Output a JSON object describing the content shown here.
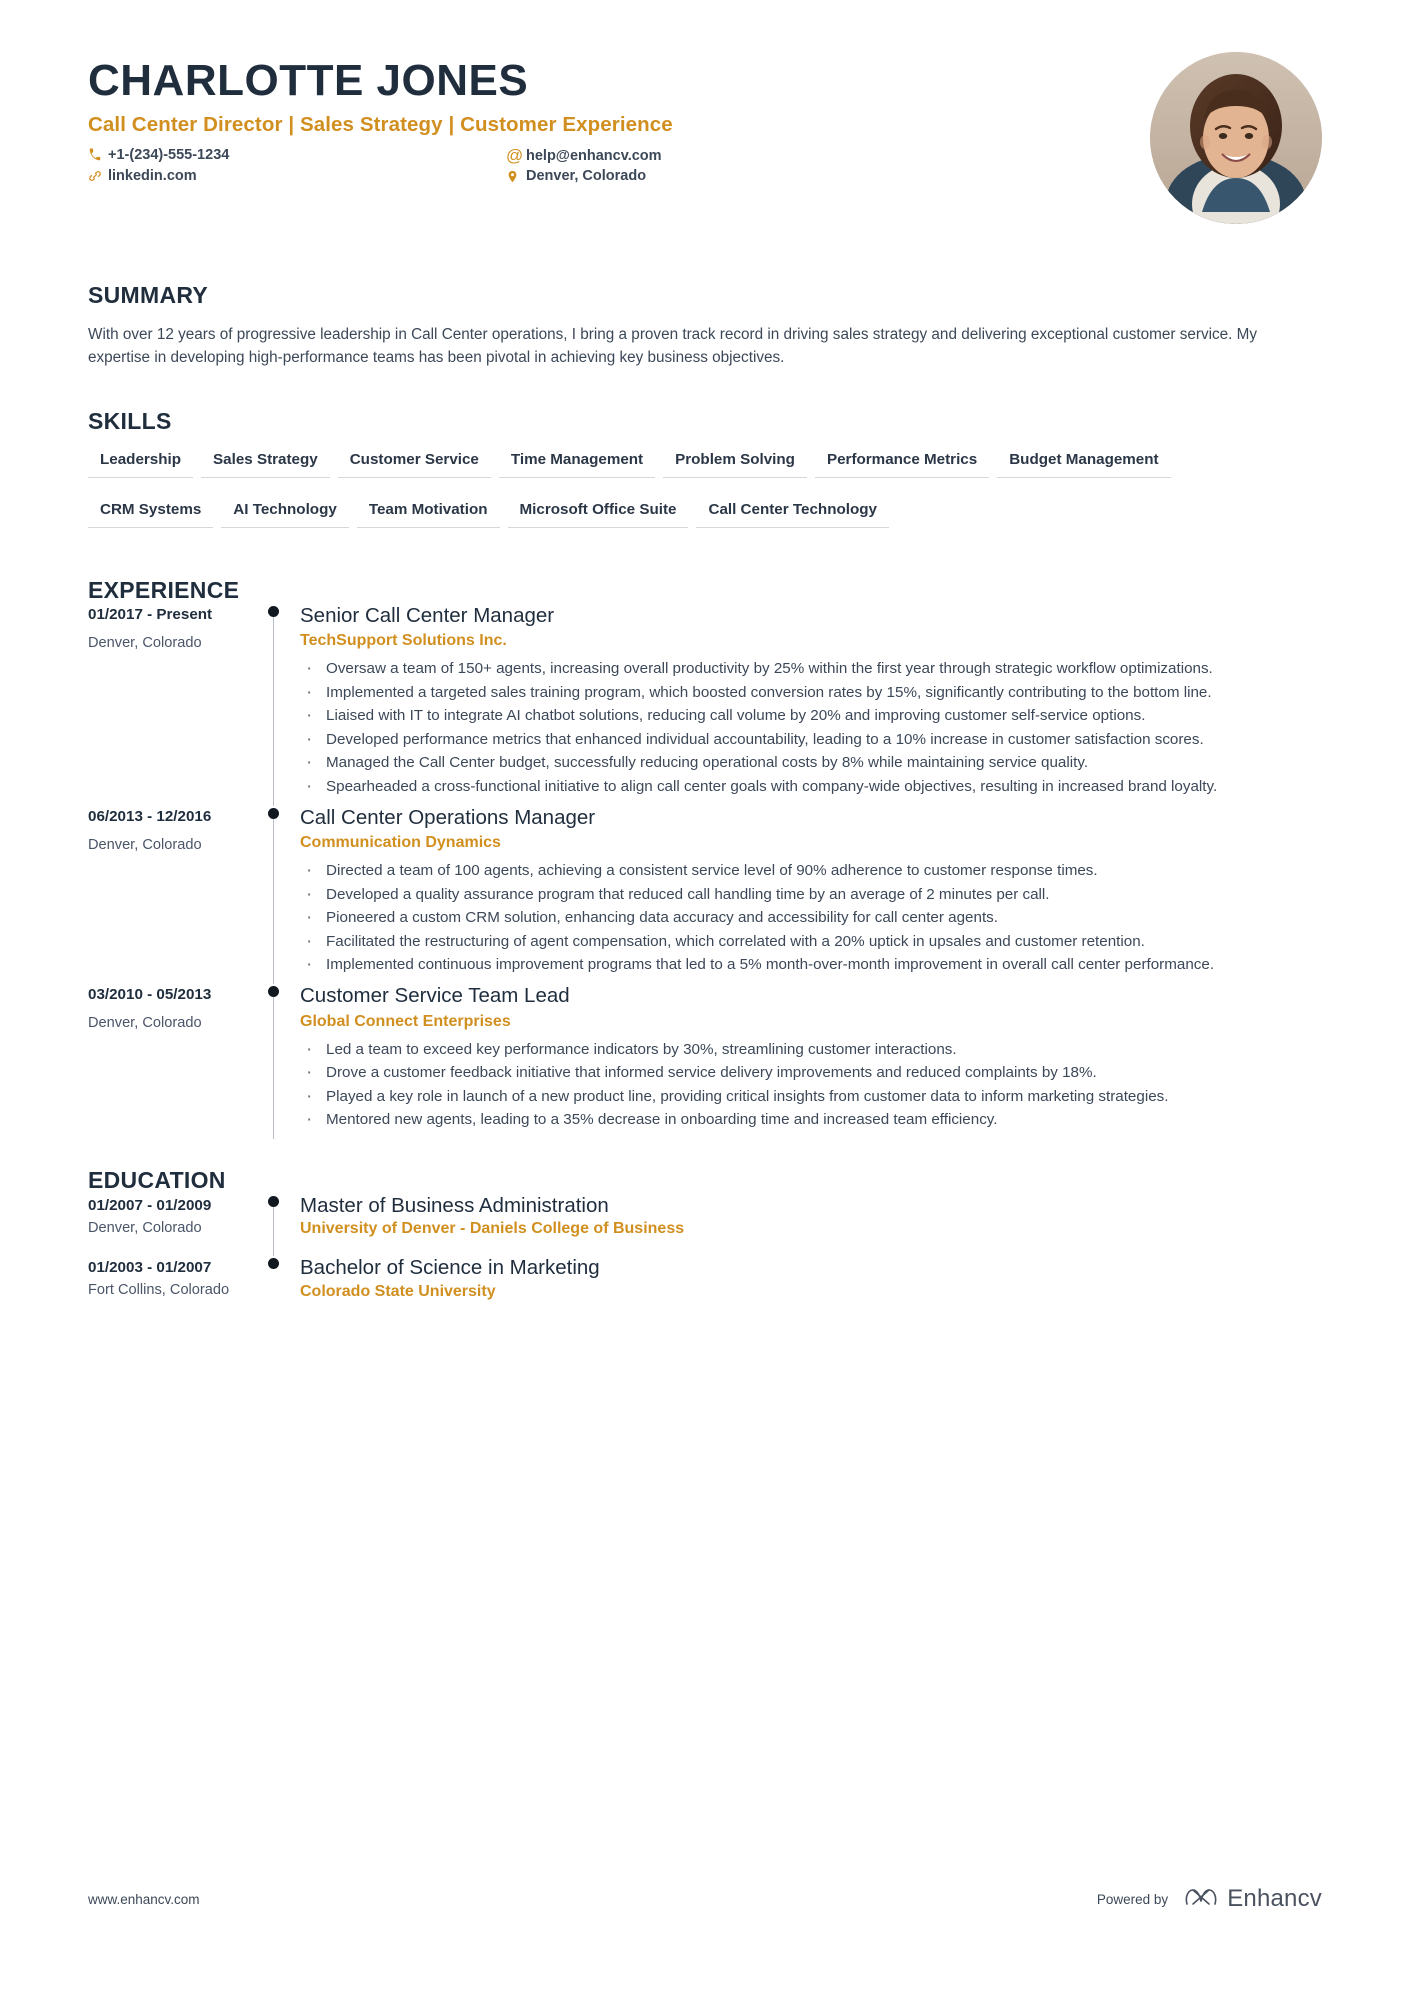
{
  "header": {
    "name": "CHARLOTTE JONES",
    "headline": "Call Center Director | Sales Strategy | Customer Experience",
    "contacts": {
      "phone": "+1-(234)-555-1234",
      "phone_icon": "phone-icon",
      "email": "help@enhancv.com",
      "email_icon": "at-icon",
      "website": "linkedin.com",
      "website_icon": "link-icon",
      "location": "Denver, Colorado",
      "location_icon": "map-pin-icon"
    },
    "photo_alt": "profile-photo"
  },
  "sections": {
    "summary": {
      "title": "SUMMARY",
      "text": "With over 12 years of progressive leadership in Call Center operations, I bring a proven track record in driving sales strategy and delivering exceptional customer service. My expertise in developing high-performance teams has been pivotal in achieving key business objectives."
    },
    "skills": {
      "title": "SKILLS",
      "items": [
        "Leadership",
        "Sales Strategy",
        "Customer Service",
        "Time Management",
        "Problem Solving",
        "Performance Metrics",
        "Budget Management",
        "CRM Systems",
        "AI Technology",
        "Team Motivation",
        "Microsoft Office Suite",
        "Call Center Technology"
      ]
    },
    "experience": {
      "title": "EXPERIENCE",
      "entries": [
        {
          "date": "01/2017 - Present",
          "location": "Denver, Colorado",
          "title": "Senior Call Center Manager",
          "organization": "TechSupport Solutions Inc.",
          "bullets": [
            "Oversaw a team of 150+ agents, increasing overall productivity by 25% within the first year through strategic workflow optimizations.",
            "Implemented a targeted sales training program, which boosted conversion rates by 15%, significantly contributing to the bottom line.",
            "Liaised with IT to integrate AI chatbot solutions, reducing call volume by 20% and improving customer self-service options.",
            "Developed performance metrics that enhanced individual accountability, leading to a 10% increase in customer satisfaction scores.",
            "Managed the Call Center budget, successfully reducing operational costs by 8% while maintaining service quality.",
            "Spearheaded a cross-functional initiative to align call center goals with company-wide objectives, resulting in increased brand loyalty."
          ]
        },
        {
          "date": "06/2013 - 12/2016",
          "location": "Denver, Colorado",
          "title": "Call Center Operations Manager",
          "organization": "Communication Dynamics",
          "bullets": [
            "Directed a team of 100 agents, achieving a consistent service level of 90% adherence to customer response times.",
            "Developed a quality assurance program that reduced call handling time by an average of 2 minutes per call.",
            "Pioneered a custom CRM solution, enhancing data accuracy and accessibility for call center agents.",
            "Facilitated the restructuring of agent compensation, which correlated with a 20% uptick in upsales and customer retention.",
            "Implemented continuous improvement programs that led to a 5% month-over-month improvement in overall call center performance."
          ]
        },
        {
          "date": "03/2010 - 05/2013",
          "location": "Denver, Colorado",
          "title": "Customer Service Team Lead",
          "organization": "Global Connect Enterprises",
          "bullets": [
            "Led a team to exceed key performance indicators by 30%, streamlining customer interactions.",
            "Drove a customer feedback initiative that informed service delivery improvements and reduced complaints by 18%.",
            "Played a key role in launch of a new product line, providing critical insights from customer data to inform marketing strategies.",
            "Mentored new agents, leading to a 35% decrease in onboarding time and increased team efficiency."
          ]
        }
      ]
    },
    "education": {
      "title": "EDUCATION",
      "entries": [
        {
          "date": "01/2007 - 01/2009",
          "location": "Denver, Colorado",
          "title": "Master of Business Administration",
          "organization": "University of Denver - Daniels College of Business"
        },
        {
          "date": "01/2003 - 01/2007",
          "location": "Fort Collins, Colorado",
          "title": "Bachelor of Science in Marketing",
          "organization": "Colorado State University"
        }
      ]
    }
  },
  "footer": {
    "url": "www.enhancv.com",
    "powered_by": "Powered by",
    "brand_name": "Enhancv",
    "brand_icon": "enhancv-logo-icon"
  },
  "colors": {
    "accent": "#d18f20",
    "heading": "#1f2d3d",
    "body": "#3c4858",
    "rule": "#d4d7dc"
  }
}
